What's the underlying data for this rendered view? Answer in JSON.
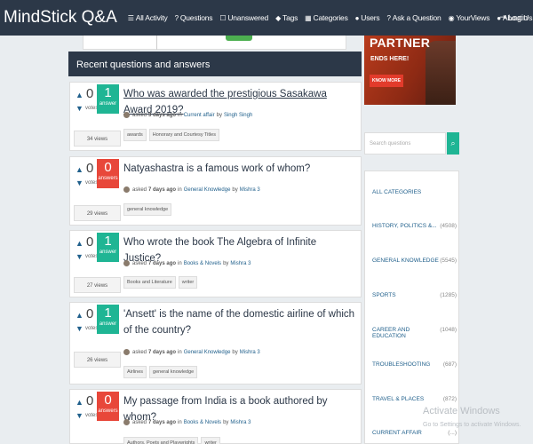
{
  "brand": "MindStick Q&A",
  "nav": [
    {
      "icon": "list-icon",
      "glyph": "☰",
      "label": "All Activity"
    },
    {
      "icon": "question-icon",
      "glyph": "?",
      "label": "Questions"
    },
    {
      "icon": "unanswered-icon",
      "glyph": "☐",
      "label": "Unanswered"
    },
    {
      "icon": "tag-icon",
      "glyph": "◆",
      "label": "Tags"
    },
    {
      "icon": "categories-icon",
      "glyph": "▦",
      "label": "Categories"
    },
    {
      "icon": "users-icon",
      "glyph": "●",
      "label": "Users"
    },
    {
      "icon": "ask-icon",
      "glyph": "?",
      "label": "Ask a Question"
    },
    {
      "icon": "yourviews-icon",
      "glyph": "◉",
      "label": "YourViews"
    },
    {
      "icon": "about-icon",
      "glyph": "●",
      "label": "About Us"
    }
  ],
  "login": "Login",
  "ad": {
    "title": "PARTNER",
    "sub": "ENDS HERE!",
    "button": "KNOW MORE"
  },
  "section_title": "Recent questions and answers",
  "questions": [
    {
      "votes": "0",
      "votes_label": "votes",
      "answers": "1",
      "answers_label": "answer",
      "answer_color": "#1fb594",
      "title": "Who was awarded the prestigious Sasakawa Award 2019?",
      "asked": "asked",
      "when": "3 days ago",
      "in": "in",
      "category": "Current affair",
      "by": "by",
      "author": "Singh Singh",
      "views": "34 views",
      "tags": [
        "awards",
        "Honorary and Courtesy Titles"
      ]
    },
    {
      "votes": "0",
      "votes_label": "votes",
      "answers": "0",
      "answers_label": "answers",
      "answer_color": "#e8473a",
      "title": "Natyashastra is a famous work of whom?",
      "asked": "asked",
      "when": "7 days ago",
      "in": "in",
      "category": "General Knowledge",
      "by": "by",
      "author": "Mishra 3",
      "views": "29 views",
      "tags": [
        "general knowledge"
      ]
    },
    {
      "votes": "0",
      "votes_label": "votes",
      "answers": "1",
      "answers_label": "answer",
      "answer_color": "#1fb594",
      "title": "Who wrote the book The Algebra of Infinite Justice?",
      "asked": "asked",
      "when": "7 days ago",
      "in": "in",
      "category": "Books & Novels",
      "by": "by",
      "author": "Mishra 3",
      "views": "27 views",
      "tags": [
        "Books and Literature",
        "writer"
      ]
    },
    {
      "votes": "0",
      "votes_label": "votes",
      "answers": "1",
      "answers_label": "answer",
      "answer_color": "#1fb594",
      "title": "'Ansett' is the name of the domestic airline of which of the country?",
      "asked": "asked",
      "when": "7 days ago",
      "in": "in",
      "category": "General Knowledge",
      "by": "by",
      "author": "Mishra 3",
      "views": "26 views",
      "tags": [
        "Airlines",
        "general knowledge"
      ]
    },
    {
      "votes": "0",
      "votes_label": "votes",
      "answers": "0",
      "answers_label": "answers",
      "answer_color": "#e8473a",
      "title": "My passage from India is a book authored by whom?",
      "asked": "asked",
      "when": "7 days ago",
      "in": "in",
      "category": "Books & Novels",
      "by": "by",
      "author": "Mishra 3",
      "views": "",
      "tags": [
        "Authors, Poets and Playwrights",
        "writer"
      ]
    }
  ],
  "search": {
    "placeholder": "Search questions",
    "icon": "search-icon"
  },
  "categories": [
    {
      "label": "ALL CATEGORIES",
      "count": ""
    },
    {
      "label": "HISTORY, POLITICS &...",
      "count": "(4508)"
    },
    {
      "label": "GENERAL KNOWLEDGE",
      "count": "(5545)"
    },
    {
      "label": "SPORTS",
      "count": "(1285)"
    },
    {
      "label": "CAREER AND EDUCATION",
      "count": "(1048)"
    },
    {
      "label": "TROUBLESHOOTING",
      "count": "(687)"
    },
    {
      "label": "TRAVEL & PLACES",
      "count": "(872)"
    },
    {
      "label": "CURRENT AFFAIR",
      "count": "(...)"
    }
  ],
  "watermark": {
    "title": "Activate Windows",
    "sub": "Go to Settings to activate Windows."
  }
}
